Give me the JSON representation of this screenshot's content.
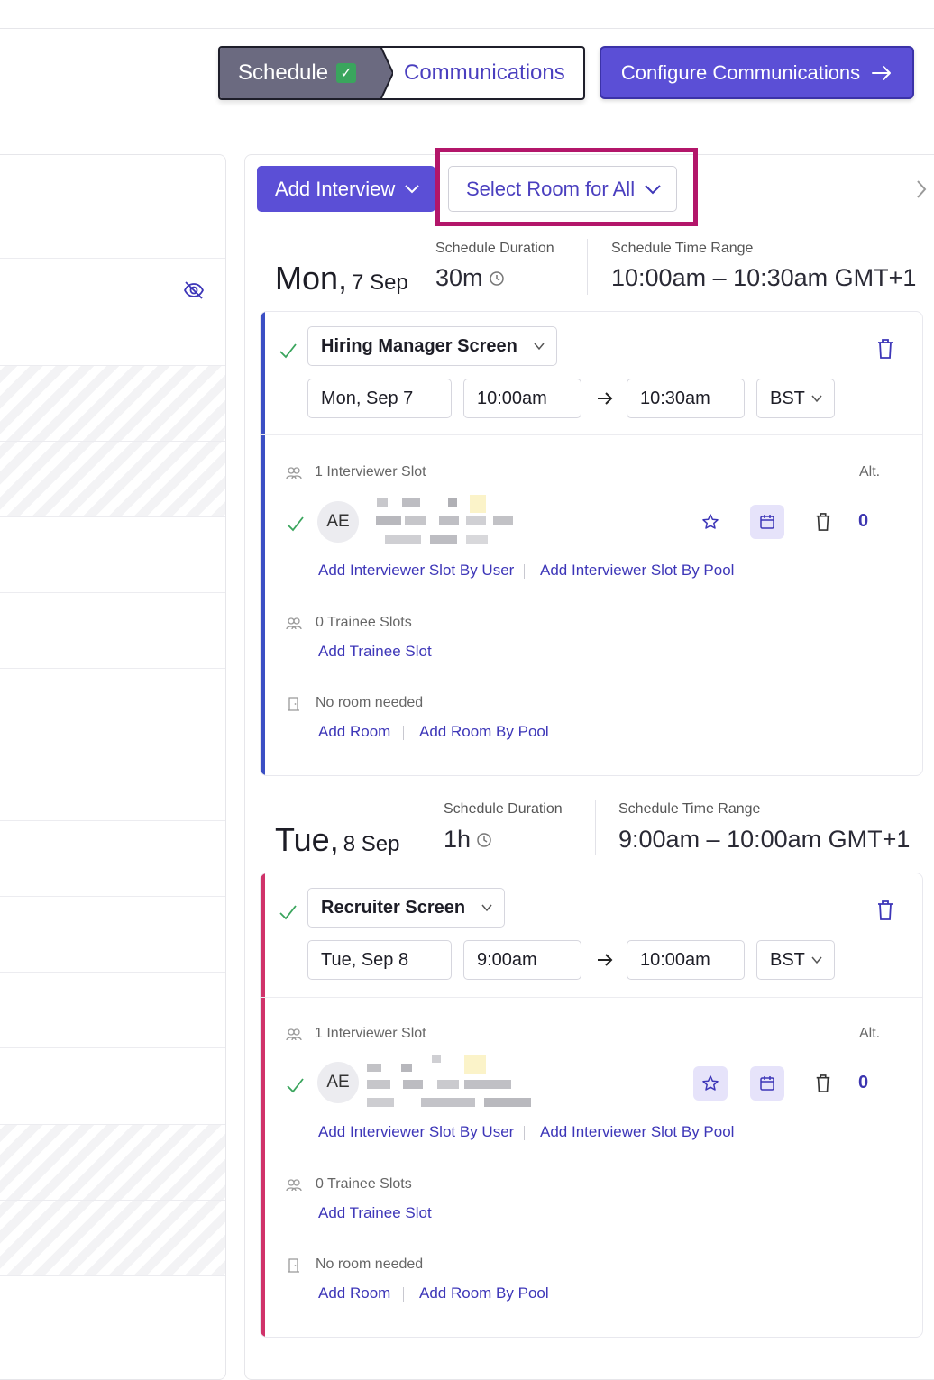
{
  "stepper": {
    "step1_label": "Schedule",
    "step2_label": "Communications"
  },
  "header": {
    "configure_label": "Configure Communications"
  },
  "toolbar": {
    "add_interview_label": "Add Interview",
    "select_room_label": "Select Room for All"
  },
  "colors": {
    "primary": "#5b4fd6",
    "link": "#3d36b8",
    "success": "#3aa55d",
    "highlight": "#b3166a",
    "day1_accent": "#3b4fc4",
    "day2_accent": "#d0336a"
  },
  "days": [
    {
      "weekday": "Mon,",
      "date": "7 Sep",
      "duration_label": "Schedule Duration",
      "duration": "30m",
      "range_label": "Schedule Time Range",
      "range": "10:00am – 10:30am GMT+1",
      "interview": {
        "name": "Hiring Manager Screen",
        "date": "Mon, Sep 7",
        "start": "10:00am",
        "end": "10:30am",
        "timezone": "BST",
        "interviewer_slots": "1 Interviewer Slot",
        "alt_label": "Alt.",
        "avatar_initials": "AE",
        "alt_count": "0",
        "add_by_user": "Add Interviewer Slot By User",
        "add_by_pool": "Add Interviewer Slot By Pool",
        "trainee_slots": "0 Trainee Slots",
        "add_trainee": "Add Trainee Slot",
        "room_status": "No room needed",
        "add_room": "Add Room",
        "add_room_pool": "Add Room By Pool"
      }
    },
    {
      "weekday": "Tue,",
      "date": "8 Sep",
      "duration_label": "Schedule Duration",
      "duration": "1h",
      "range_label": "Schedule Time Range",
      "range": "9:00am – 10:00am GMT+1",
      "interview": {
        "name": "Recruiter Screen",
        "date": "Tue, Sep 8",
        "start": "9:00am",
        "end": "10:00am",
        "timezone": "BST",
        "interviewer_slots": "1 Interviewer Slot",
        "alt_label": "Alt.",
        "avatar_initials": "AE",
        "alt_count": "0",
        "add_by_user": "Add Interviewer Slot By User",
        "add_by_pool": "Add Interviewer Slot By Pool",
        "trainee_slots": "0 Trainee Slots",
        "add_trainee": "Add Trainee Slot",
        "room_status": "No room needed",
        "add_room": "Add Room",
        "add_room_pool": "Add Room By Pool"
      }
    }
  ],
  "icons": [
    "check-icon",
    "arrow-right-icon",
    "chevron-down-icon",
    "chevron-right-icon",
    "eye-off-icon",
    "trash-icon",
    "people-icon",
    "door-icon",
    "star-icon",
    "calendar-icon",
    "clock-icon"
  ]
}
